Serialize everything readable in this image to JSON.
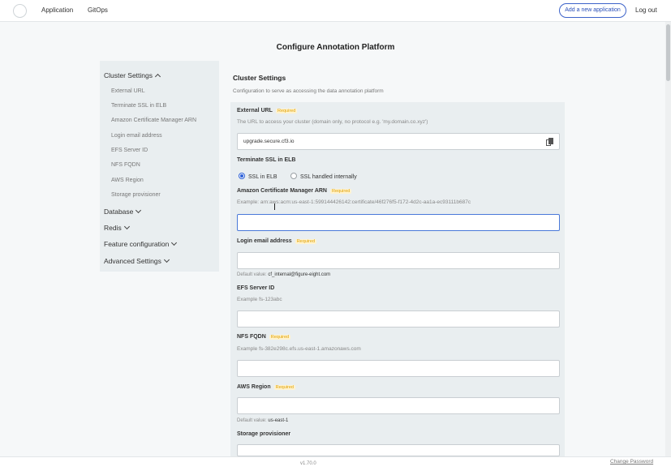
{
  "nav": {
    "application": "Application",
    "gitops": "GitOps",
    "add_app": "Add a new application",
    "logout": "Log out"
  },
  "page_title": "Configure Annotation Platform",
  "sidebar": {
    "cluster": "Cluster Settings",
    "items": [
      "External URL",
      "Terminate SSL in ELB",
      "Amazon Certificate Manager ARN",
      "Login email address",
      "EFS Server ID",
      "NFS FQDN",
      "AWS Region",
      "Storage provisioner"
    ],
    "database": "Database",
    "redis": "Redis",
    "feature": "Feature configuration",
    "advanced": "Advanced Settings"
  },
  "section": {
    "title": "Cluster Settings",
    "desc": "Configuration to serve as accessing the data annotation platform"
  },
  "required": "Required",
  "fields": {
    "external_url": {
      "label": "External URL",
      "hint": "The URL to access your cluster (domain only, no protocol e.g. 'my.domain.co.xyz')",
      "value": "upgrade.secure.cf3.io"
    },
    "terminate_ssl": {
      "label": "Terminate SSL in ELB",
      "opt1": "SSL in ELB",
      "opt2": "SSL handled internally",
      "selected": "SSL in ELB"
    },
    "acm_arn": {
      "label": "Amazon Certificate Manager ARN",
      "hint": "Example: arn:aws:acm:us-east-1:599144426142:certificate/46f276f5-f172-4d2c-aa1a-ec93111b687c",
      "value": ""
    },
    "login_email": {
      "label": "Login email address",
      "default_prefix": "Default value:",
      "default": "cf_internal@figure-eight.com"
    },
    "efs": {
      "label": "EFS Server ID",
      "hint": "Example fs-123abc"
    },
    "nfs": {
      "label": "NFS FQDN",
      "hint": "Example fs-382e298c.efs.us-east-1.amazonaws.com"
    },
    "region": {
      "label": "AWS Region",
      "default_prefix": "Default value:",
      "default": "us-east-1"
    },
    "storage": {
      "label": "Storage provisioner"
    }
  },
  "footer": {
    "version": "v1.70.0",
    "change_password": "Change Password"
  },
  "colors": {
    "accent": "#2f62d8",
    "required": "#e0a000",
    "panel": "#e9eef0"
  },
  "icons": {
    "copy": "clipboard-icon",
    "logo": "logo-icon"
  }
}
